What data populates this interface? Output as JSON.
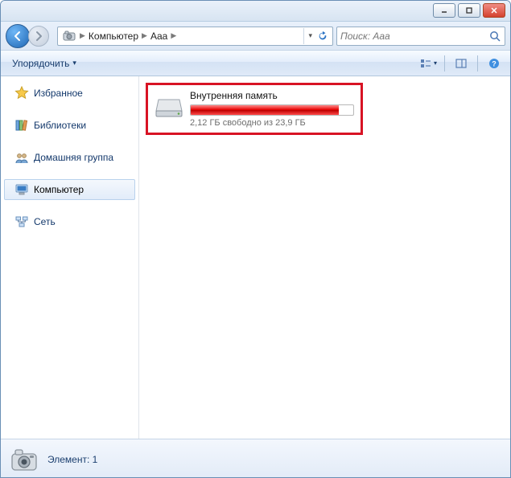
{
  "window": {
    "controls": {
      "min": "_",
      "max": "▢",
      "close": "✕"
    }
  },
  "address": {
    "crumbs": [
      "Компьютер",
      "Aaa"
    ],
    "icon": "camera-device-icon"
  },
  "search": {
    "placeholder": "Поиск: Aaa"
  },
  "toolbar": {
    "organize_label": "Упорядочить"
  },
  "sidebar": {
    "favorites": {
      "label": "Избранное"
    },
    "libraries": {
      "label": "Библиотеки"
    },
    "homegroup": {
      "label": "Домашняя группа"
    },
    "computer": {
      "label": "Компьютер"
    },
    "network": {
      "label": "Сеть"
    }
  },
  "drive": {
    "name": "Внутренняя память",
    "free_text": "2,12 ГБ свободно из 23,9 ГБ",
    "fill_percent": 91
  },
  "status": {
    "text": "Элемент: 1"
  },
  "colors": {
    "highlight_border": "#d81324"
  }
}
